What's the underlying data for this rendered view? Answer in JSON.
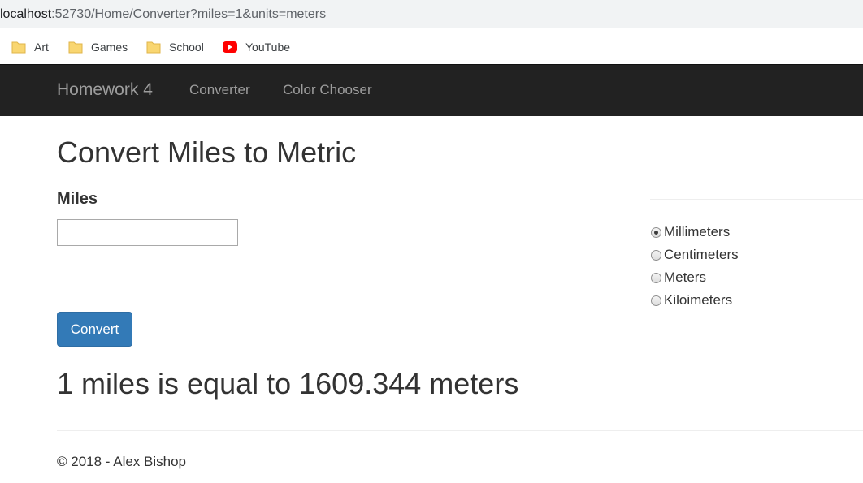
{
  "browser": {
    "url_host": "localhost",
    "url_path": ":52730/Home/Converter?miles=1&units=meters",
    "bookmarks": [
      {
        "label": "Art",
        "icon": "folder-icon"
      },
      {
        "label": "Games",
        "icon": "folder-icon"
      },
      {
        "label": "School",
        "icon": "folder-icon"
      },
      {
        "label": "YouTube",
        "icon": "youtube-icon"
      }
    ]
  },
  "navbar": {
    "brand": "Homework 4",
    "links": [
      "Converter",
      "Color Chooser"
    ],
    "background": "#222222",
    "link_color": "#9d9d9d"
  },
  "main": {
    "title": "Convert Miles to Metric",
    "miles_label": "Miles",
    "miles_value": "",
    "units": [
      {
        "label": "Millimeters",
        "checked": true
      },
      {
        "label": "Centimeters",
        "checked": false
      },
      {
        "label": "Meters",
        "checked": false
      },
      {
        "label": "Kiloimeters",
        "checked": false
      }
    ],
    "convert_label": "Convert",
    "result": "1 miles is equal to 1609.344 meters",
    "button_color": "#337ab7"
  },
  "footer": {
    "text": "© 2018 - Alex Bishop"
  }
}
